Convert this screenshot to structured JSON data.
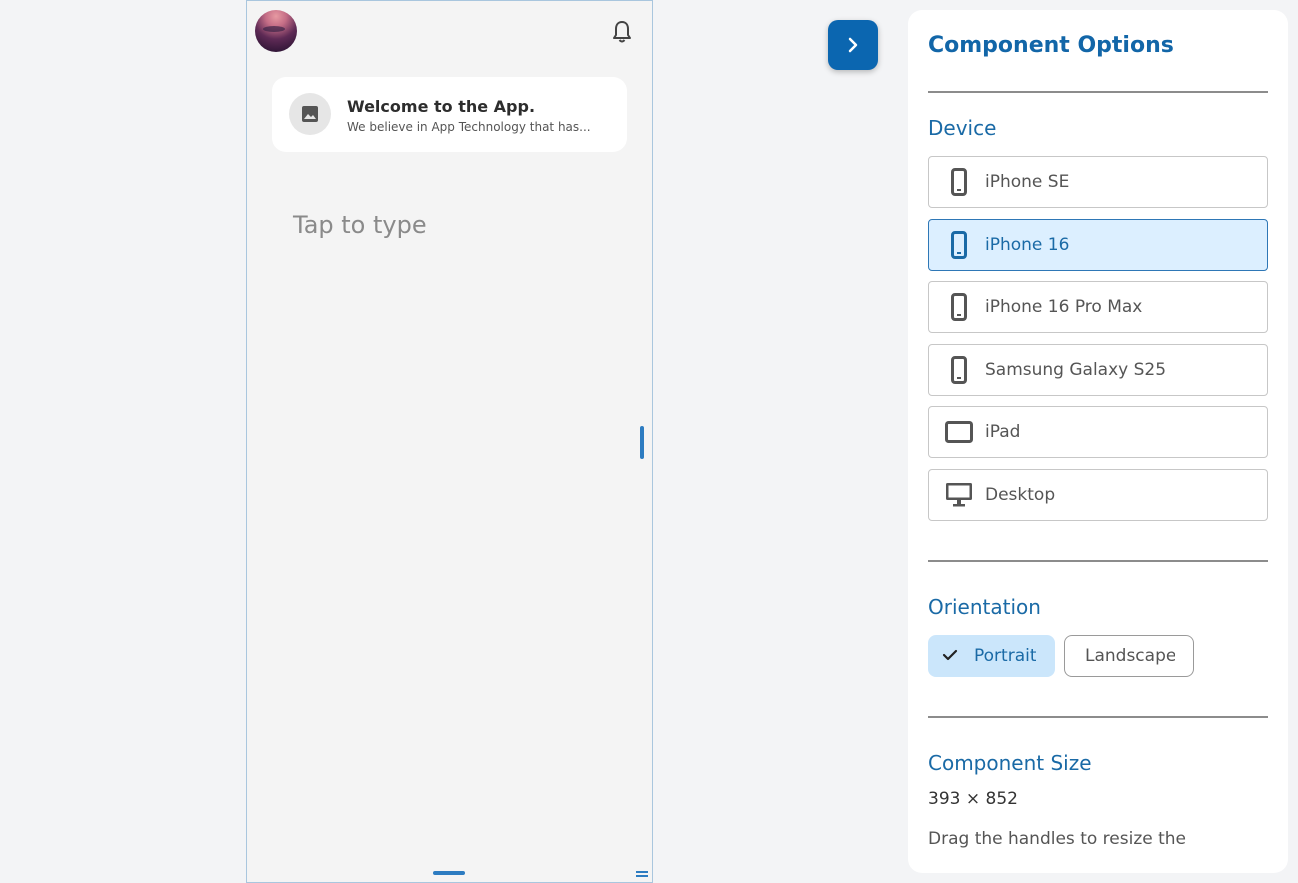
{
  "phone": {
    "card": {
      "title": "Welcome to the App.",
      "subtitle": "We believe in App Technology that has..."
    },
    "input_placeholder": "Tap to type"
  },
  "panel": {
    "title": "Component Options",
    "device_section": "Device",
    "devices": [
      {
        "label": "iPhone SE",
        "icon": "phone-icon",
        "selected": false
      },
      {
        "label": "iPhone 16",
        "icon": "phone-icon",
        "selected": true
      },
      {
        "label": "iPhone 16 Pro Max",
        "icon": "phone-icon",
        "selected": false
      },
      {
        "label": "Samsung Galaxy S25",
        "icon": "phone-icon",
        "selected": false
      },
      {
        "label": "iPad",
        "icon": "tablet-icon",
        "selected": false
      },
      {
        "label": "Desktop",
        "icon": "desktop-icon",
        "selected": false
      }
    ],
    "orientation_section": "Orientation",
    "orientation": {
      "portrait_label": "Portrait",
      "landscape_label": "Landscape",
      "selected": "Portrait"
    },
    "size_section": "Component Size",
    "size_value": "393 × 852",
    "size_hint": "Drag the handles to resize the"
  },
  "colors": {
    "accent": "#0b66b0",
    "selected_bg": "#dcefff",
    "panel_heading": "#1266a8"
  }
}
